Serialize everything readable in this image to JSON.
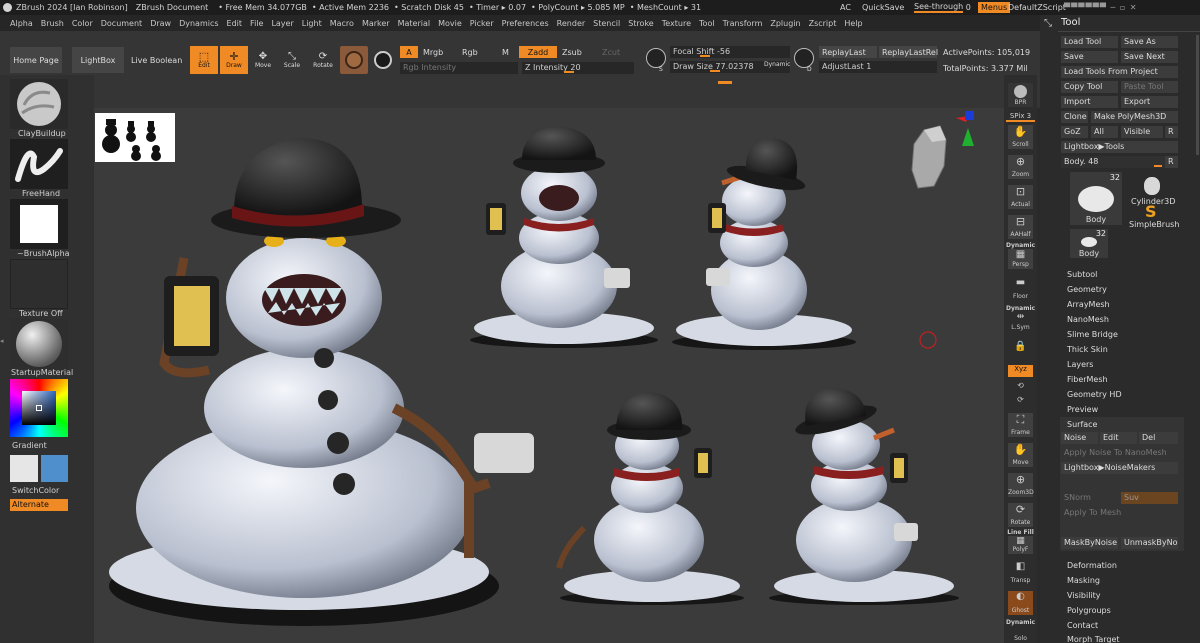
{
  "titlebar": {
    "app": "ZBrush 2024 [Ian Robinson]",
    "document": "ZBrush Document",
    "free_mem": "• Free Mem 34.077GB",
    "active_mem": "• Active Mem 2236",
    "scratch": "• Scratch Disk 45",
    "timer": "• Timer ▸ 0.07",
    "polycount": "• PolyCount ▸ 5.085 MP",
    "meshcount": "• MeshCount ▸ 31",
    "ac": "AC",
    "quicksave": "QuickSave",
    "see_through": "See-through",
    "see_through_value": "0",
    "menus": "Menus",
    "default_zscript": "DefaultZScript"
  },
  "menu": [
    "Alpha",
    "Brush",
    "Color",
    "Document",
    "Draw",
    "Dynamics",
    "Edit",
    "File",
    "Layer",
    "Light",
    "Macro",
    "Marker",
    "Material",
    "Movie",
    "Picker",
    "Preferences",
    "Render",
    "Stencil",
    "Stroke",
    "Texture",
    "Tool",
    "Transform",
    "Zplugin",
    "Zscript",
    "Help"
  ],
  "shelf": {
    "home_page": "Home Page",
    "lightbox": "LightBox",
    "live_boolean": "Live Boolean",
    "edit": "Edit",
    "draw": "Draw",
    "move": "Move",
    "scale": "Scale",
    "rotate": "Rotate",
    "a": "A",
    "mrgb": "Mrgb",
    "rgb": "Rgb",
    "m": "M",
    "zadd": "Zadd",
    "zsub": "Zsub",
    "zcut": "Zcut",
    "rgb_intensity": "Rgb Intensity",
    "z_intensity": "Z Intensity 20",
    "focal_shift": "Focal Shift -56",
    "draw_size": "Draw Size 77.02378",
    "dynamic": "Dynamic",
    "s_key": "S",
    "d_key": "D",
    "replay_last": "ReplayLast",
    "replay_last_rel": "ReplayLastRel",
    "adjust_last": "AdjustLast 1",
    "active_points": "ActivePoints: 105,019",
    "total_points": "TotalPoints: 3.377 Mil"
  },
  "left": {
    "brush": "ClayBuildup",
    "stroke": "FreeHand",
    "alpha": "~BrushAlpha",
    "texture": "Texture Off",
    "material": "StartupMaterial",
    "gradient": "Gradient",
    "switch_color": "SwitchColor",
    "alternate": "Alternate"
  },
  "right": {
    "bpr": "BPR",
    "spix": "SPix 3",
    "scroll": "Scroll",
    "zoom": "Zoom",
    "actual": "Actual",
    "aahalf": "AAHalf",
    "dynamic": "Dynamic",
    "persp": "Persp",
    "floor": "Floor",
    "lsym": "L.Sym",
    "xyz": "Xyz",
    "frame": "Frame",
    "move": "Move",
    "zoom3d": "Zoom3D",
    "rotate": "Rotate",
    "line_fill": "Line Fill",
    "polyf": "PolyF",
    "transp": "Transp",
    "ghost": "Ghost",
    "dynamic2": "Dynamic",
    "solo": "Solo"
  },
  "tool": {
    "title": "Tool",
    "load_tool": "Load Tool",
    "save_as": "Save As",
    "save": "Save",
    "save_next": "Save Next",
    "load_tools_from_project": "Load Tools From Project",
    "copy_tool": "Copy Tool",
    "paste_tool": "Paste Tool",
    "import": "Import",
    "export": "Export",
    "clone": "Clone",
    "make_polymesh3d": "Make PolyMesh3D",
    "goz": "GoZ",
    "all": "All",
    "visible": "Visible",
    "r": "R",
    "lightbox_tools": "Lightbox▶Tools",
    "body_slider": "Body. 48",
    "thumb_count": "32",
    "body": "Body",
    "cylinder3d": "Cylinder3D",
    "simplebrush": "SimpleBrush",
    "body2_count": "32",
    "body2": "Body",
    "sections": [
      "Subtool",
      "Geometry",
      "ArrayMesh",
      "NanoMesh",
      "Slime Bridge",
      "Thick Skin",
      "Layers",
      "FiberMesh",
      "Geometry HD",
      "Preview",
      "Surface"
    ],
    "noise": "Noise",
    "edit": "Edit",
    "del": "Del",
    "apply_noise": "Apply Noise To NanoMesh",
    "noisemakers": "Lightbox▶NoiseMakers",
    "snorm": "SNorm",
    "suv": "Suv",
    "apply_to_mesh": "Apply To Mesh",
    "mask_by_noise": "MaskByNoise",
    "unmask_by_noise": "UnmaskByNoise",
    "sections2": [
      "Deformation",
      "Masking",
      "Visibility",
      "Polygroups",
      "Contact",
      "Morph Target"
    ]
  },
  "colors": {
    "accent": "#f08a24",
    "canvas": "#3b3b3b",
    "shelf": "#353535"
  }
}
